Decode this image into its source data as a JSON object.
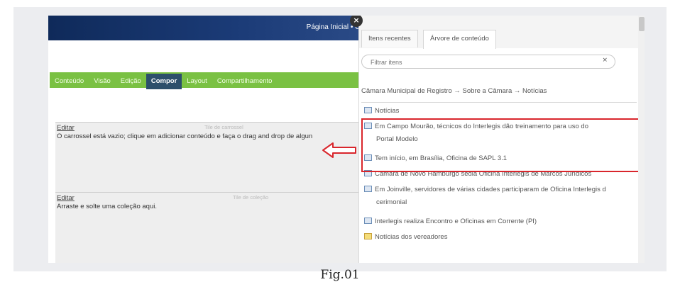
{
  "topbar": {
    "links": "Página Inicial  •  O"
  },
  "nav": {
    "items": [
      "Conteúdo",
      "Visão",
      "Edição",
      "Compor",
      "Layout",
      "Compartilhamento"
    ],
    "active": "Compor"
  },
  "tiles": [
    {
      "edit_label": "Editar",
      "title": "Tile de carrossel",
      "text": "O carrossel está vazio; clique em adicionar conteúdo e faça o drag and drop de algun"
    },
    {
      "edit_label": "Editar",
      "title": "Tile de coleção",
      "text": "Arraste e solte uma coleção aqui."
    }
  ],
  "panel": {
    "tabs": [
      "Itens recentes",
      "Árvore de conteúdo"
    ],
    "active_tab": "Árvore de conteúdo",
    "filter_placeholder": "Filtrar itens",
    "filter_clear": "×",
    "breadcrumb": "Câmara Municipal de Registro → Sobre a Câmara → Notícias",
    "items": [
      {
        "label": "Notícias",
        "icon": "collection-icon"
      },
      {
        "label": "Em Campo Mourão, técnicos do Interlegis dão treinamento para uso do",
        "label2": "Portal Modelo",
        "icon": "news-icon"
      },
      {
        "label": "Tem início, em Brasília, Oficina de SAPL 3.1",
        "icon": "news-icon"
      },
      {
        "label": "Câmara de Novo Hamburgo sedia Oficina Interlegis de Marcos Jurídicos",
        "icon": "news-icon"
      },
      {
        "label": "Em Joinville, servidores de várias cidades participaram de Oficina Interlegis d",
        "label2": "cerimonial",
        "icon": "news-icon"
      },
      {
        "label": "Interlegis realiza Encontro e Oficinas em Corrente (PI)",
        "icon": "news-icon"
      },
      {
        "label": "Notícias dos vereadores",
        "icon": "folder-icon"
      }
    ]
  },
  "close_symbol": "×",
  "caption": "Fig.01",
  "colors": {
    "nav": "#7ac143",
    "nav_active": "#2c4f6b",
    "topbar": "#0f2a5a",
    "highlight": "#d9262c"
  }
}
